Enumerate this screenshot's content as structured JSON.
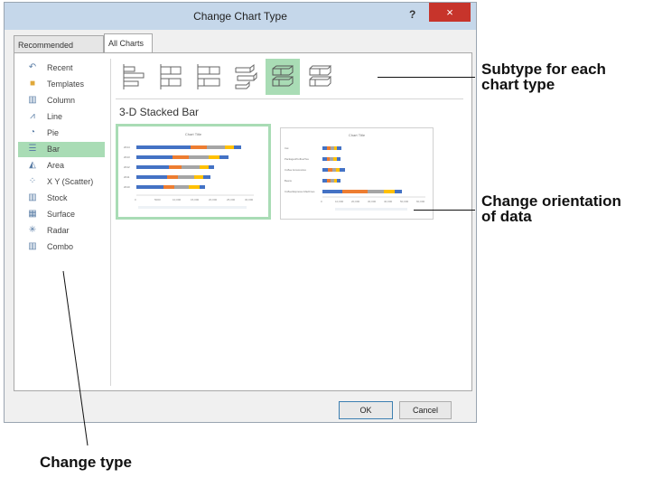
{
  "dialog": {
    "title": "Change Chart Type",
    "help": "?",
    "close": "×",
    "tabs": [
      "Recommended Charts",
      "All Charts"
    ],
    "chart_types": [
      {
        "label": "Recent",
        "icon": "recent-icon"
      },
      {
        "label": "Templates",
        "icon": "templates-folder-icon"
      },
      {
        "label": "Column",
        "icon": "column-chart-icon"
      },
      {
        "label": "Line",
        "icon": "line-chart-icon"
      },
      {
        "label": "Pie",
        "icon": "pie-chart-icon"
      },
      {
        "label": "Bar",
        "icon": "bar-chart-icon",
        "selected": true
      },
      {
        "label": "Area",
        "icon": "area-chart-icon"
      },
      {
        "label": "X Y (Scatter)",
        "icon": "scatter-chart-icon"
      },
      {
        "label": "Stock",
        "icon": "stock-chart-icon"
      },
      {
        "label": "Surface",
        "icon": "surface-chart-icon"
      },
      {
        "label": "Radar",
        "icon": "radar-chart-icon"
      },
      {
        "label": "Combo",
        "icon": "combo-chart-icon"
      }
    ],
    "selected_subtype_index": 4,
    "subtype_name": "3-D Stacked Bar",
    "preview_title": "Chart Title",
    "preview_left": {
      "categories": [
        "2014",
        "2013",
        "2012",
        "2011",
        "2010"
      ],
      "axis": [
        "0",
        "5000",
        "10,000",
        "15,000",
        "20,000",
        "25,000",
        "30,000"
      ]
    },
    "preview_right": {
      "categories": [
        "Cat",
        "Packaged/Coffee/Tea",
        "Coffee Accessories",
        "Beans",
        "Coffee/Espresso Machines"
      ],
      "axis": [
        "0",
        "10,000",
        "20,000",
        "30,000",
        "40,000",
        "50,000",
        "60,000"
      ]
    },
    "ok": "OK",
    "cancel": "Cancel"
  },
  "callouts": {
    "subtype": "Subtype for each chart type",
    "subtype_line1": "Subtype for each",
    "subtype_line2": "chart type",
    "orientation_line1": "Change orientation",
    "orientation_line2": "of data",
    "change_type": "Change type"
  },
  "colors": {
    "selection": "#a9dcb5",
    "titlebar": "#c5d7ea",
    "close": "#c7342b",
    "series": [
      "#4472c4",
      "#ed7d31",
      "#a5a5a5",
      "#ffc000",
      "#5b9bd5"
    ]
  }
}
